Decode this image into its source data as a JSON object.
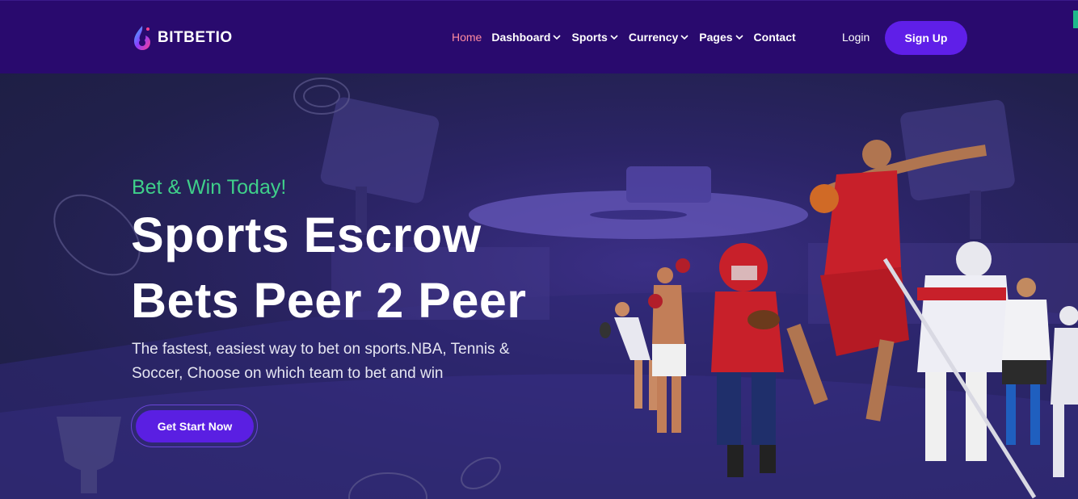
{
  "header": {
    "brand": "BITBETIO",
    "nav": [
      {
        "label": "Home",
        "active": true,
        "dropdown": false
      },
      {
        "label": "Dashboard",
        "active": false,
        "dropdown": true
      },
      {
        "label": "Sports",
        "active": false,
        "dropdown": true
      },
      {
        "label": "Currency",
        "active": false,
        "dropdown": true
      },
      {
        "label": "Pages",
        "active": false,
        "dropdown": true
      },
      {
        "label": "Contact",
        "active": false,
        "dropdown": false
      }
    ],
    "login_label": "Login",
    "signup_label": "Sign Up"
  },
  "hero": {
    "tagline": "Bet & Win Today!",
    "title_line1": "Sports Escrow",
    "title_line2": "Bets Peer 2 Peer",
    "description": "The fastest, easiest way to bet on sports.NBA, Tennis & Soccer, Choose on which team to bet and win",
    "cta_label": "Get Start Now"
  },
  "colors": {
    "nav_bg": "#290a6e",
    "hero_bg": "#1f2044",
    "accent_purple": "#5f1fe8",
    "tagline_green": "#3fd08a",
    "active_link": "#ff8ba0"
  }
}
